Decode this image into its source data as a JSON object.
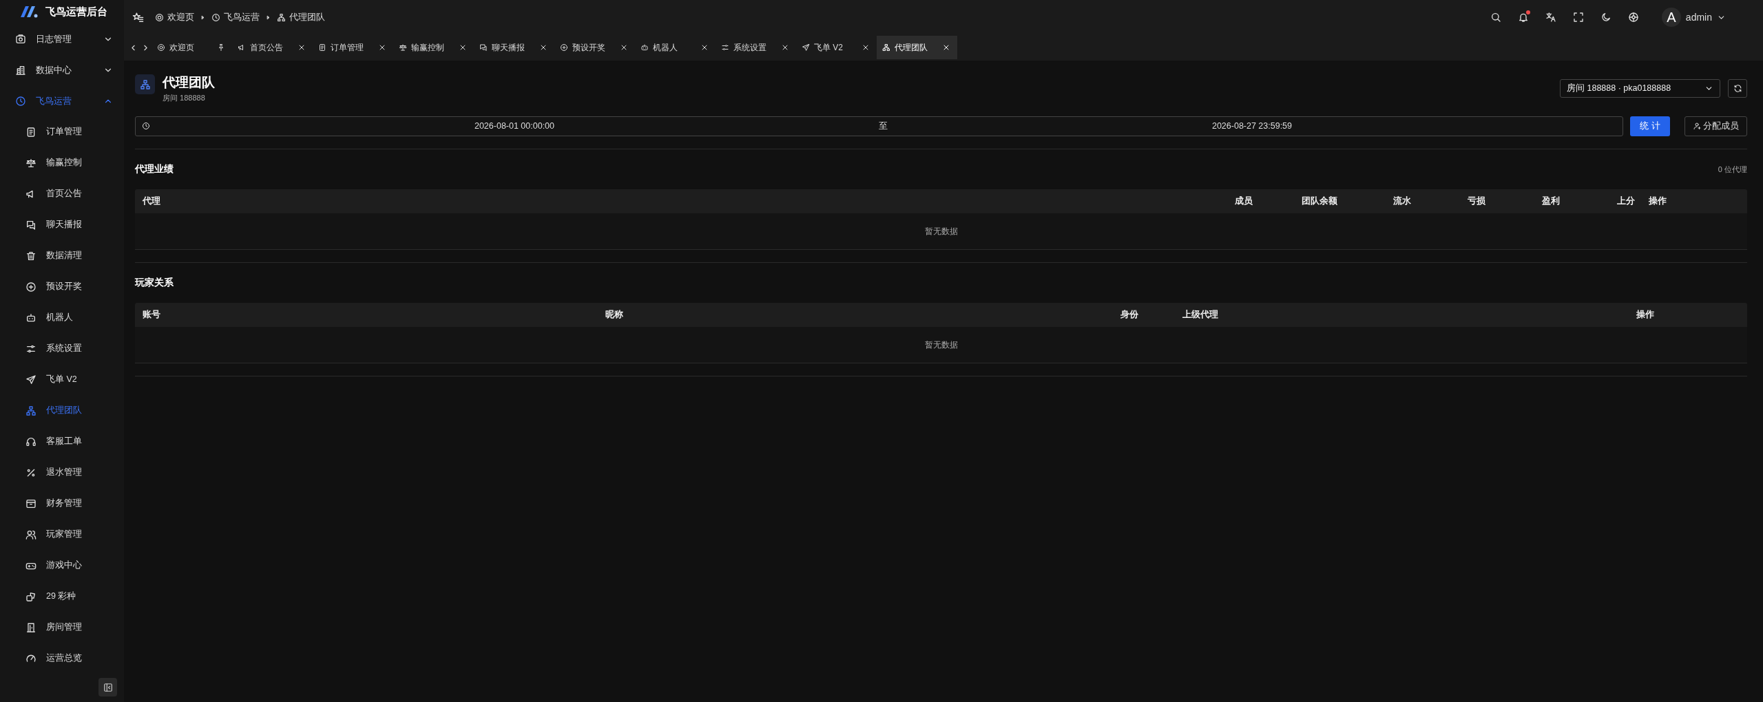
{
  "app": {
    "title": "飞鸟运营后台"
  },
  "sidebar": {
    "items": [
      {
        "label": "日志管理",
        "expanded": false
      },
      {
        "label": "数据中心",
        "expanded": false
      },
      {
        "label": "飞鸟运营",
        "expanded": true,
        "children": [
          {
            "label": "订单管理",
            "selected": false
          },
          {
            "label": "输赢控制",
            "selected": false
          },
          {
            "label": "首页公告",
            "selected": false
          },
          {
            "label": "聊天播报",
            "selected": false
          },
          {
            "label": "数据清理",
            "selected": false
          },
          {
            "label": "预设开奖",
            "selected": false
          },
          {
            "label": "机器人",
            "selected": false
          },
          {
            "label": "系统设置",
            "selected": false
          },
          {
            "label": "飞单 V2",
            "selected": false
          },
          {
            "label": "代理团队",
            "selected": true
          },
          {
            "label": "客服工单",
            "selected": false
          },
          {
            "label": "退水管理",
            "selected": false
          },
          {
            "label": "财务管理",
            "selected": false
          },
          {
            "label": "玩家管理",
            "selected": false
          },
          {
            "label": "游戏中心",
            "selected": false
          },
          {
            "label": "29 彩种",
            "selected": false
          },
          {
            "label": "房间管理",
            "selected": false
          },
          {
            "label": "运营总览",
            "selected": false
          }
        ]
      }
    ]
  },
  "breadcrumb": [
    {
      "label": "欢迎页"
    },
    {
      "label": "飞鸟运营"
    },
    {
      "label": "代理团队"
    }
  ],
  "notifications": {
    "unread": true
  },
  "user": {
    "avatar": "A",
    "name": "admin"
  },
  "tabs": [
    {
      "label": "欢迎页",
      "pinned": true,
      "selected": false
    },
    {
      "label": "首页公告",
      "pinned": false,
      "selected": false
    },
    {
      "label": "订单管理",
      "pinned": false,
      "selected": false
    },
    {
      "label": "输赢控制",
      "pinned": false,
      "selected": false
    },
    {
      "label": "聊天播报",
      "pinned": false,
      "selected": false
    },
    {
      "label": "预设开奖",
      "pinned": false,
      "selected": false
    },
    {
      "label": "机器人",
      "pinned": false,
      "selected": false
    },
    {
      "label": "系统设置",
      "pinned": false,
      "selected": false
    },
    {
      "label": "飞单 V2",
      "pinned": false,
      "selected": false
    },
    {
      "label": "代理团队",
      "pinned": false,
      "selected": true
    }
  ],
  "page": {
    "title": "代理团队",
    "subtitle": "房间 188888",
    "room_select": {
      "value": "房间 188888 · pka0188888"
    },
    "date_range": {
      "start": "2026-08-01 00:00:00",
      "separator": "至",
      "end": "2026-08-27 23:59:59"
    },
    "buttons": [
      {
        "label": "统 计",
        "kind": "primary"
      },
      {
        "label": "分配成员",
        "kind": "assign"
      }
    ]
  },
  "sections": [
    {
      "title": "代理业绩",
      "count": "0 位代理",
      "table": {
        "columns": [
          "代理",
          "成员",
          "团队余额",
          "流水",
          "亏损",
          "盈利",
          "上分",
          "操作"
        ],
        "empty_text": "暂无数据"
      }
    },
    {
      "title": "玩家关系",
      "table": {
        "columns": [
          "账号",
          "昵称",
          "身份",
          "上级代理",
          "操作"
        ],
        "empty_text": "暂无数据"
      }
    }
  ]
}
